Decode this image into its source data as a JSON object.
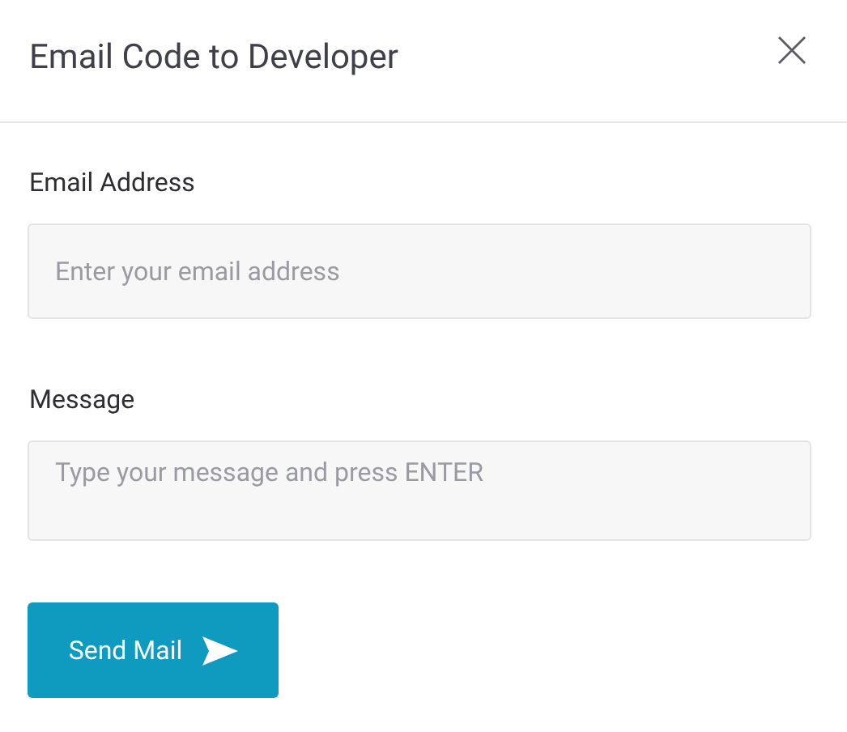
{
  "dialog": {
    "title": "Email Code to Developer"
  },
  "fields": [
    {
      "kind": "input",
      "label": "Email Address",
      "placeholder": "Enter your email address"
    },
    {
      "kind": "textarea",
      "label": "Message",
      "placeholder": "Type your message and press ENTER"
    }
  ],
  "send_button": {
    "label": "Send Mail"
  }
}
